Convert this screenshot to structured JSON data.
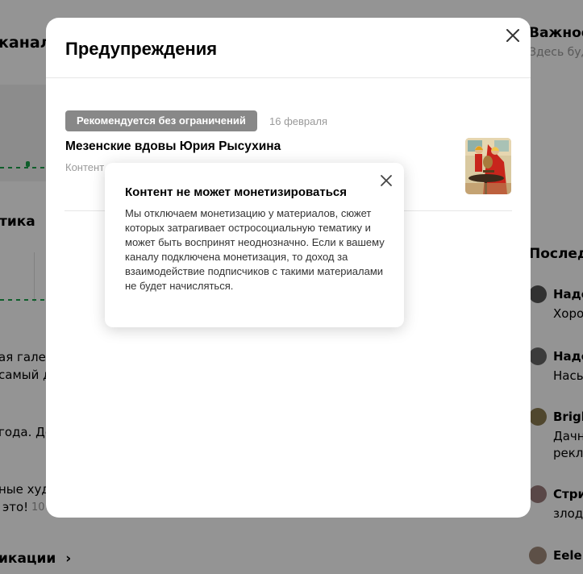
{
  "background": {
    "channel_title_fragment": "канал",
    "stats_heading_fragment": "тика",
    "gallery_line1": "ая галере",
    "gallery_line2": "самый д",
    "year_line": "года. Де",
    "artists_line1": "ные худо",
    "artists_line2": "это!",
    "artists_count": "10",
    "publications_link": "икации",
    "important_title": "Важное",
    "important_sub": "Здесь буд",
    "recent_title": "Последн",
    "comments": [
      {
        "author": "Наде",
        "text": "Хоро"
      },
      {
        "author": "Наде",
        "text": "Насы"
      },
      {
        "author": "Brigh",
        "text": "Дачн",
        "text2": "рекла"
      },
      {
        "author": "Стри",
        "text": "злоде"
      },
      {
        "author": "Eelen",
        "text": ""
      }
    ],
    "accent_color": "#1aa34a"
  },
  "modal": {
    "title": "Предупреждения",
    "close_icon": "close-icon",
    "items": [
      {
        "badge": "Рекомендуется без ограничений",
        "date": "16 февраля",
        "title": "Мезенские вдовы Юрия Рысухина",
        "subtitle": "Контент",
        "badge_color": "#888888"
      }
    ]
  },
  "tooltip": {
    "title": "Контент не может монетизироваться",
    "body": "Мы отключаем монетизацию у материалов, сюжет которых затрагивает остросоциальную тематику и может быть воспринят неоднозначно. Если к вашему каналу подключена монетизация, то доход за взаимодействие подписчиков с такими материалами не будет начисляться.",
    "close_icon": "close-icon"
  }
}
